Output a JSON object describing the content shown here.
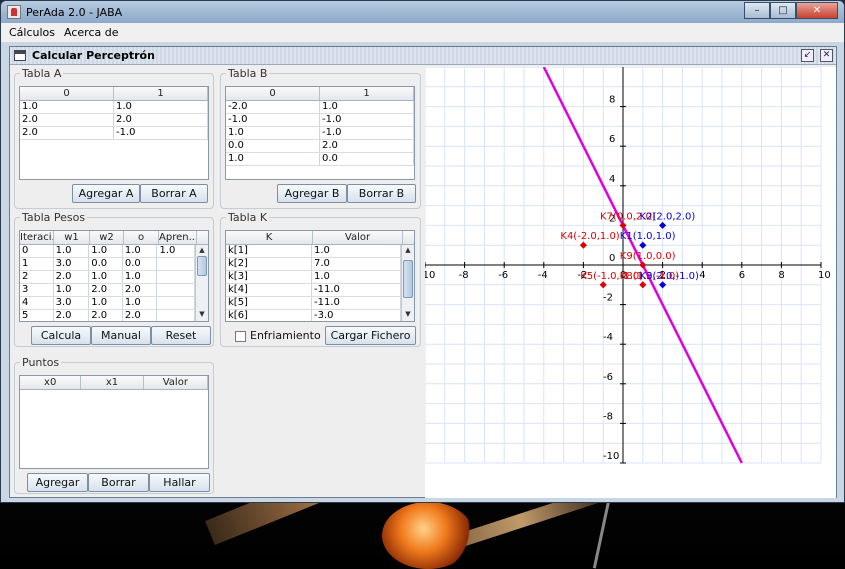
{
  "window": {
    "title": "PerAda 2.0 - JABA",
    "btn_min": "–",
    "btn_max": "□",
    "btn_close": "✕"
  },
  "menu": [
    "Cálculos",
    "Acerca de"
  ],
  "frame": {
    "title": "Calcular Perceptrón",
    "btn_restore": "↙",
    "btn_close": "✕"
  },
  "tabla_a": {
    "title": "Tabla A",
    "columns": [
      "0",
      "1"
    ],
    "rows": [
      [
        "1.0",
        "1.0"
      ],
      [
        "2.0",
        "2.0"
      ],
      [
        "2.0",
        "-1.0"
      ]
    ],
    "add_label": "Agregar A",
    "del_label": "Borrar A"
  },
  "tabla_b": {
    "title": "Tabla B",
    "columns": [
      "0",
      "1"
    ],
    "rows": [
      [
        "-2.0",
        "1.0"
      ],
      [
        "-1.0",
        "-1.0"
      ],
      [
        "1.0",
        "-1.0"
      ],
      [
        "0.0",
        "2.0"
      ],
      [
        "1.0",
        "0.0"
      ]
    ],
    "add_label": "Agregar B",
    "del_label": "Borrar B"
  },
  "tabla_pesos": {
    "title": "Tabla Pesos",
    "columns": [
      "Iteraci...",
      "w1",
      "w2",
      "o",
      "Apren..."
    ],
    "rows": [
      [
        "0",
        "1.0",
        "1.0",
        "1.0",
        "1.0"
      ],
      [
        "1",
        "3.0",
        "0.0",
        "0.0",
        ""
      ],
      [
        "2",
        "2.0",
        "1.0",
        "1.0",
        ""
      ],
      [
        "3",
        "1.0",
        "2.0",
        "2.0",
        ""
      ],
      [
        "4",
        "3.0",
        "1.0",
        "1.0",
        ""
      ],
      [
        "5",
        "2.0",
        "2.0",
        "2.0",
        ""
      ]
    ],
    "calc_label": "Calcula",
    "manual_label": "Manual",
    "reset_label": "Reset"
  },
  "tabla_k": {
    "title": "Tabla K",
    "columns": [
      "K",
      "Valor"
    ],
    "rows": [
      [
        "k[1]",
        "1.0"
      ],
      [
        "k[2]",
        "7.0"
      ],
      [
        "k[3]",
        "1.0"
      ],
      [
        "k[4]",
        "-11.0"
      ],
      [
        "k[5]",
        "-11.0"
      ],
      [
        "k[6]",
        "-3.0"
      ]
    ],
    "cooling_label": "Enfriamiento",
    "load_label": "Cargar Fichero"
  },
  "puntos": {
    "title": "Puntos",
    "columns": [
      "x0",
      "x1",
      "Valor"
    ],
    "add_label": "Agregar",
    "del_label": "Borrar",
    "find_label": "Hallar"
  },
  "plot": {
    "x_ticks": [
      "-10",
      "-8",
      "-6",
      "-4",
      "-2",
      "0",
      "2",
      "4",
      "6",
      "8",
      "10"
    ],
    "y_ticks": [
      "8",
      "6",
      "4",
      "2",
      "0",
      "-2",
      "-4",
      "-6",
      "-8",
      "-10"
    ],
    "x_range": [
      -10,
      10
    ],
    "y_range": [
      -10,
      10
    ],
    "line_color": "#e000e0",
    "line": [
      [
        -4,
        10
      ],
      [
        6,
        -10
      ]
    ],
    "points": [
      {
        "x": -2,
        "y": 1,
        "label": "K4(-2.0,1.0)",
        "color": "#dd0000"
      },
      {
        "x": 0,
        "y": 2,
        "label": "K7(0.0,2.0)",
        "color": "#dd0000"
      },
      {
        "x": 2,
        "y": 2,
        "label": "K2(2.0,2.0)",
        "color": "#0000dd"
      },
      {
        "x": 1,
        "y": 1,
        "label": "K1(1.0,1.0)",
        "color": "#0000dd"
      },
      {
        "x": 1,
        "y": 0,
        "label": "K9(1.0,0.0)",
        "color": "#dd0000"
      },
      {
        "x": -1,
        "y": -1,
        "label": "K5(-1.0,-1.0)",
        "color": "#dd0000"
      },
      {
        "x": 1,
        "y": -1,
        "label": "K8(1.0,-1.0)",
        "color": "#dd0000"
      },
      {
        "x": 2,
        "y": -1,
        "label": "K3(2.0,-1.0)",
        "color": "#0000dd"
      }
    ]
  }
}
